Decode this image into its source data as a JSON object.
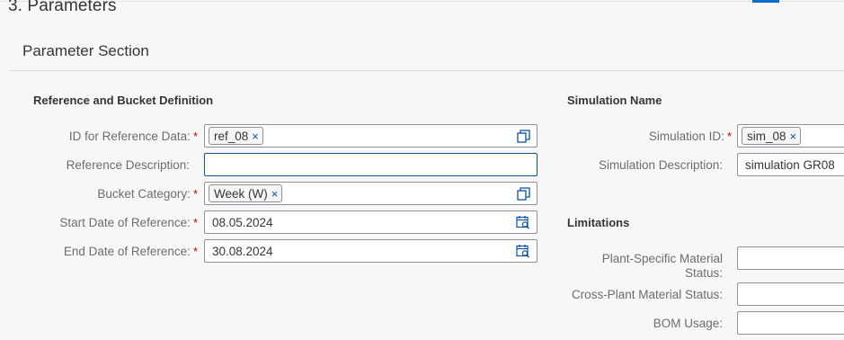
{
  "step": {
    "title": "3. Parameters"
  },
  "section": {
    "title": "Parameter Section"
  },
  "reference": {
    "title": "Reference and Bucket Definition",
    "id_label": "ID for Reference Data:",
    "id_token": "ref_08",
    "desc_label": "Reference Description:",
    "desc_value": "",
    "bucket_label": "Bucket Category:",
    "bucket_token": "Week (W)",
    "start_label": "Start Date of Reference:",
    "start_value": "08.05.2024",
    "end_label": "End Date of Reference:",
    "end_value": "30.08.2024"
  },
  "simulation": {
    "title": "Simulation Name",
    "id_label": "Simulation ID:",
    "id_token": "sim_08",
    "desc_label": "Simulation Description:",
    "desc_value": "simulation GR08"
  },
  "limitations": {
    "title": "Limitations",
    "plant_label_line1": "Plant-Specific Material",
    "plant_label_line2": "Status:",
    "plant_value": "",
    "cross_label": "Cross-Plant Material Status:",
    "cross_value": "",
    "bom_label": "BOM Usage:",
    "bom_value": ""
  },
  "required_marker": "*",
  "token_remove": "×",
  "colors": {
    "accent": "#0a6ed1",
    "required": "#bb0000",
    "link": "#0854a0"
  },
  "icons": [
    "value-help-icon",
    "calendar-icon",
    "remove-token-icon"
  ]
}
